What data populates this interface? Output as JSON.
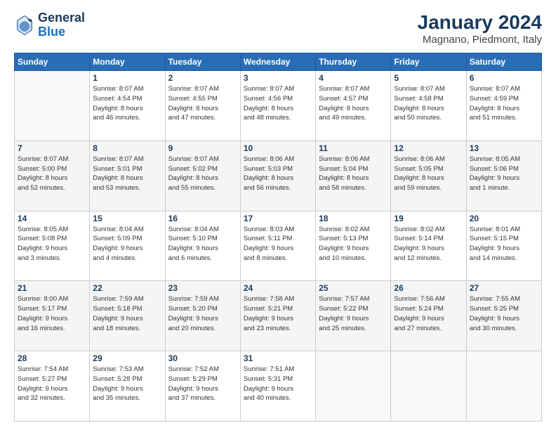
{
  "header": {
    "logo_line1": "General",
    "logo_line2": "Blue",
    "main_title": "January 2024",
    "subtitle": "Magnano, Piedmont, Italy"
  },
  "weekdays": [
    "Sunday",
    "Monday",
    "Tuesday",
    "Wednesday",
    "Thursday",
    "Friday",
    "Saturday"
  ],
  "weeks": [
    [
      {
        "day": "",
        "info": ""
      },
      {
        "day": "1",
        "info": "Sunrise: 8:07 AM\nSunset: 4:54 PM\nDaylight: 8 hours\nand 46 minutes."
      },
      {
        "day": "2",
        "info": "Sunrise: 8:07 AM\nSunset: 4:55 PM\nDaylight: 8 hours\nand 47 minutes."
      },
      {
        "day": "3",
        "info": "Sunrise: 8:07 AM\nSunset: 4:56 PM\nDaylight: 8 hours\nand 48 minutes."
      },
      {
        "day": "4",
        "info": "Sunrise: 8:07 AM\nSunset: 4:57 PM\nDaylight: 8 hours\nand 49 minutes."
      },
      {
        "day": "5",
        "info": "Sunrise: 8:07 AM\nSunset: 4:58 PM\nDaylight: 8 hours\nand 50 minutes."
      },
      {
        "day": "6",
        "info": "Sunrise: 8:07 AM\nSunset: 4:59 PM\nDaylight: 8 hours\nand 51 minutes."
      }
    ],
    [
      {
        "day": "7",
        "info": "Sunrise: 8:07 AM\nSunset: 5:00 PM\nDaylight: 8 hours\nand 52 minutes."
      },
      {
        "day": "8",
        "info": "Sunrise: 8:07 AM\nSunset: 5:01 PM\nDaylight: 8 hours\nand 53 minutes."
      },
      {
        "day": "9",
        "info": "Sunrise: 8:07 AM\nSunset: 5:02 PM\nDaylight: 8 hours\nand 55 minutes."
      },
      {
        "day": "10",
        "info": "Sunrise: 8:06 AM\nSunset: 5:03 PM\nDaylight: 8 hours\nand 56 minutes."
      },
      {
        "day": "11",
        "info": "Sunrise: 8:06 AM\nSunset: 5:04 PM\nDaylight: 8 hours\nand 58 minutes."
      },
      {
        "day": "12",
        "info": "Sunrise: 8:06 AM\nSunset: 5:05 PM\nDaylight: 8 hours\nand 59 minutes."
      },
      {
        "day": "13",
        "info": "Sunrise: 8:05 AM\nSunset: 5:06 PM\nDaylight: 9 hours\nand 1 minute."
      }
    ],
    [
      {
        "day": "14",
        "info": "Sunrise: 8:05 AM\nSunset: 5:08 PM\nDaylight: 9 hours\nand 3 minutes."
      },
      {
        "day": "15",
        "info": "Sunrise: 8:04 AM\nSunset: 5:09 PM\nDaylight: 9 hours\nand 4 minutes."
      },
      {
        "day": "16",
        "info": "Sunrise: 8:04 AM\nSunset: 5:10 PM\nDaylight: 9 hours\nand 6 minutes."
      },
      {
        "day": "17",
        "info": "Sunrise: 8:03 AM\nSunset: 5:11 PM\nDaylight: 9 hours\nand 8 minutes."
      },
      {
        "day": "18",
        "info": "Sunrise: 8:02 AM\nSunset: 5:13 PM\nDaylight: 9 hours\nand 10 minutes."
      },
      {
        "day": "19",
        "info": "Sunrise: 8:02 AM\nSunset: 5:14 PM\nDaylight: 9 hours\nand 12 minutes."
      },
      {
        "day": "20",
        "info": "Sunrise: 8:01 AM\nSunset: 5:15 PM\nDaylight: 9 hours\nand 14 minutes."
      }
    ],
    [
      {
        "day": "21",
        "info": "Sunrise: 8:00 AM\nSunset: 5:17 PM\nDaylight: 9 hours\nand 16 minutes."
      },
      {
        "day": "22",
        "info": "Sunrise: 7:59 AM\nSunset: 5:18 PM\nDaylight: 9 hours\nand 18 minutes."
      },
      {
        "day": "23",
        "info": "Sunrise: 7:59 AM\nSunset: 5:20 PM\nDaylight: 9 hours\nand 20 minutes."
      },
      {
        "day": "24",
        "info": "Sunrise: 7:58 AM\nSunset: 5:21 PM\nDaylight: 9 hours\nand 23 minutes."
      },
      {
        "day": "25",
        "info": "Sunrise: 7:57 AM\nSunset: 5:22 PM\nDaylight: 9 hours\nand 25 minutes."
      },
      {
        "day": "26",
        "info": "Sunrise: 7:56 AM\nSunset: 5:24 PM\nDaylight: 9 hours\nand 27 minutes."
      },
      {
        "day": "27",
        "info": "Sunrise: 7:55 AM\nSunset: 5:25 PM\nDaylight: 9 hours\nand 30 minutes."
      }
    ],
    [
      {
        "day": "28",
        "info": "Sunrise: 7:54 AM\nSunset: 5:27 PM\nDaylight: 9 hours\nand 32 minutes."
      },
      {
        "day": "29",
        "info": "Sunrise: 7:53 AM\nSunset: 5:28 PM\nDaylight: 9 hours\nand 35 minutes."
      },
      {
        "day": "30",
        "info": "Sunrise: 7:52 AM\nSunset: 5:29 PM\nDaylight: 9 hours\nand 37 minutes."
      },
      {
        "day": "31",
        "info": "Sunrise: 7:51 AM\nSunset: 5:31 PM\nDaylight: 9 hours\nand 40 minutes."
      },
      {
        "day": "",
        "info": ""
      },
      {
        "day": "",
        "info": ""
      },
      {
        "day": "",
        "info": ""
      }
    ]
  ]
}
